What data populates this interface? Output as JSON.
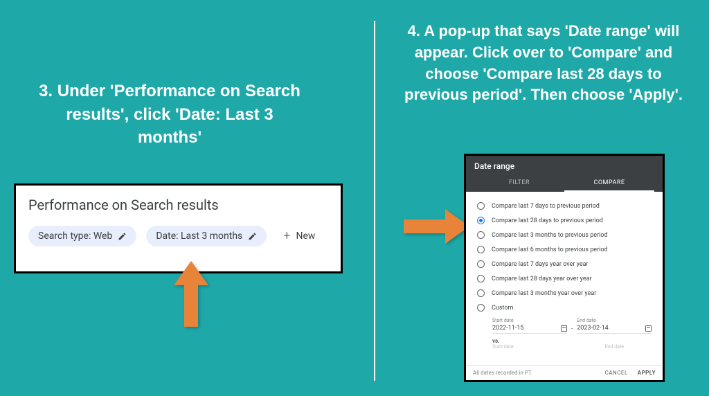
{
  "instructions": {
    "step3": "3. Under 'Performance on Search results', click 'Date: Last 3 months'",
    "step4": "4. A pop-up that says 'Date range' will appear. Click over to 'Compare' and choose 'Compare last 28 days to previous period'. Then choose 'Apply'."
  },
  "left_panel": {
    "title": "Performance on Search results",
    "chip_search_type": "Search type: Web",
    "chip_date": "Date: Last 3 months",
    "new_label": "New"
  },
  "modal": {
    "title": "Date range",
    "tabs": {
      "filter": "FILTER",
      "compare": "COMPARE"
    },
    "options": [
      "Compare last 7 days to previous period",
      "Compare last 28 days to previous period",
      "Compare last 3 months to previous period",
      "Compare last 6 months to previous period",
      "Compare last 7 days year over year",
      "Compare last 28 days year over year",
      "Compare last 3 months year over year",
      "Custom"
    ],
    "selected_index": 1,
    "date_fields": {
      "start_label": "Start date",
      "start_value": "2022-11-15",
      "end_label": "End date",
      "end_value": "2023-02-14"
    },
    "vs_label": "vs.",
    "faded": {
      "start": "Start date",
      "end": "End date"
    },
    "footer": {
      "note": "All dates recorded in PT.",
      "cancel": "CANCEL",
      "apply": "APPLY"
    }
  },
  "colors": {
    "bg": "#1fa8a8",
    "arrow": "#e8833a",
    "chip_bg": "#e8eefb",
    "modal_header": "#3c4043",
    "accent": "#1a73e8"
  }
}
